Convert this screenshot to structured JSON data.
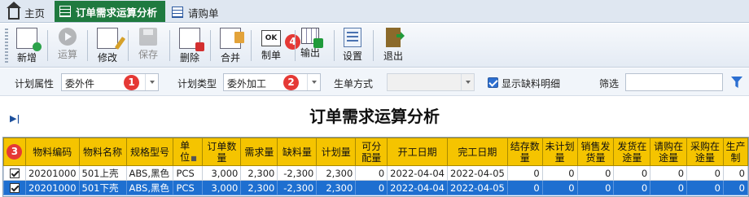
{
  "tabs": [
    {
      "label": "主页",
      "icon": "home-icon",
      "active": false
    },
    {
      "label": "订单需求运算分析",
      "icon": "grid-icon",
      "active": true
    },
    {
      "label": "请购单",
      "icon": "grid-icon",
      "active": false
    }
  ],
  "toolbar": {
    "buttons": [
      {
        "label": "新增",
        "icon": "new-icon",
        "enabled": true
      },
      {
        "label": "运算",
        "icon": "run-icon",
        "enabled": false
      },
      {
        "label": "修改",
        "icon": "edit-icon",
        "enabled": true
      },
      {
        "label": "保存",
        "icon": "save-icon",
        "enabled": false
      },
      {
        "label": "删除",
        "icon": "delete-icon",
        "enabled": true
      },
      {
        "label": "合并",
        "icon": "merge-icon",
        "enabled": true
      },
      {
        "label": "制单",
        "icon": "create-order-icon",
        "enabled": true
      },
      {
        "label": "输出",
        "icon": "export-icon",
        "enabled": true
      },
      {
        "label": "设置",
        "icon": "settings-icon",
        "enabled": true
      },
      {
        "label": "退出",
        "icon": "exit-icon",
        "enabled": true
      }
    ],
    "ok_text": "OK"
  },
  "badges": [
    "1",
    "2",
    "3",
    "4"
  ],
  "filters": {
    "plan_attr_label": "计划属性",
    "plan_attr_value": "委外件",
    "plan_type_label": "计划类型",
    "plan_type_value": "委外加工",
    "gen_mode_label": "生单方式",
    "gen_mode_value": "",
    "show_shortage_label": "显示缺料明细",
    "show_shortage_checked": true,
    "filter_label": "筛选",
    "filter_value": ""
  },
  "collapse_glyph": "▶|",
  "page_title": "订单需求运算分析",
  "grid": {
    "columns": [
      "物料编码",
      "物料名称",
      "规格型号",
      "单位",
      "订单数量",
      "需求量",
      "缺料量",
      "计划量",
      "可分配量",
      "开工日期",
      "完工日期",
      "结存数量",
      "未计划量",
      "销售发货量",
      "发货在途量",
      "请购在途量",
      "采购在途量",
      "生产制"
    ],
    "rows": [
      {
        "checked": true,
        "selected": false,
        "cells": [
          "20201000",
          "501上壳",
          "ABS,黑色",
          "PCS",
          "3,000",
          "2,300",
          "-2,300",
          "2,300",
          "0",
          "2022-04-04",
          "2022-04-05",
          "0",
          "0",
          "0",
          "0",
          "0",
          "0",
          "0"
        ]
      },
      {
        "checked": true,
        "selected": true,
        "cells": [
          "20201000",
          "501下壳",
          "ABS,黑色",
          "PCS",
          "3,000",
          "2,300",
          "-2,300",
          "2,300",
          "0",
          "2022-04-04",
          "2022-04-05",
          "0",
          "0",
          "0",
          "0",
          "0",
          "0",
          "0"
        ]
      }
    ]
  },
  "colors": {
    "accent_tab": "#1f7a3f",
    "header_yellow": "#f5c400",
    "selected_row": "#1e6fd0",
    "badge_red": "#e53935"
  }
}
